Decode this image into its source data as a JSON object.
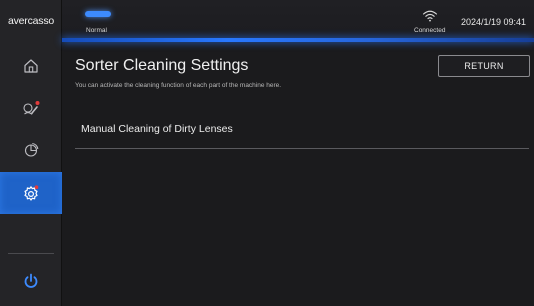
{
  "brand": {
    "logo_text": "avercasso"
  },
  "status_bar": {
    "machine_status": "Normal",
    "network_status": "Connected",
    "datetime": "2024/1/19 09:41"
  },
  "sidebar": {
    "items": [
      {
        "name": "home",
        "icon": "home-icon"
      },
      {
        "name": "ai-recognition",
        "icon": "ai-brush-icon"
      },
      {
        "name": "statistics",
        "icon": "pie-chart-icon"
      },
      {
        "name": "settings",
        "icon": "gear-icon",
        "active": true
      },
      {
        "name": "power",
        "icon": "power-icon"
      }
    ]
  },
  "main": {
    "title": "Sorter Cleaning Settings",
    "description": "You can activate the cleaning function of each part of the machine here.",
    "return_label": "RETURN",
    "options": [
      {
        "label": "Manual Cleaning of Dirty Lenses"
      }
    ]
  },
  "colors": {
    "accent": "#1f63c8",
    "background": "#1b1b1d",
    "sidebar": "#242427",
    "notification": "#e23b3b"
  }
}
